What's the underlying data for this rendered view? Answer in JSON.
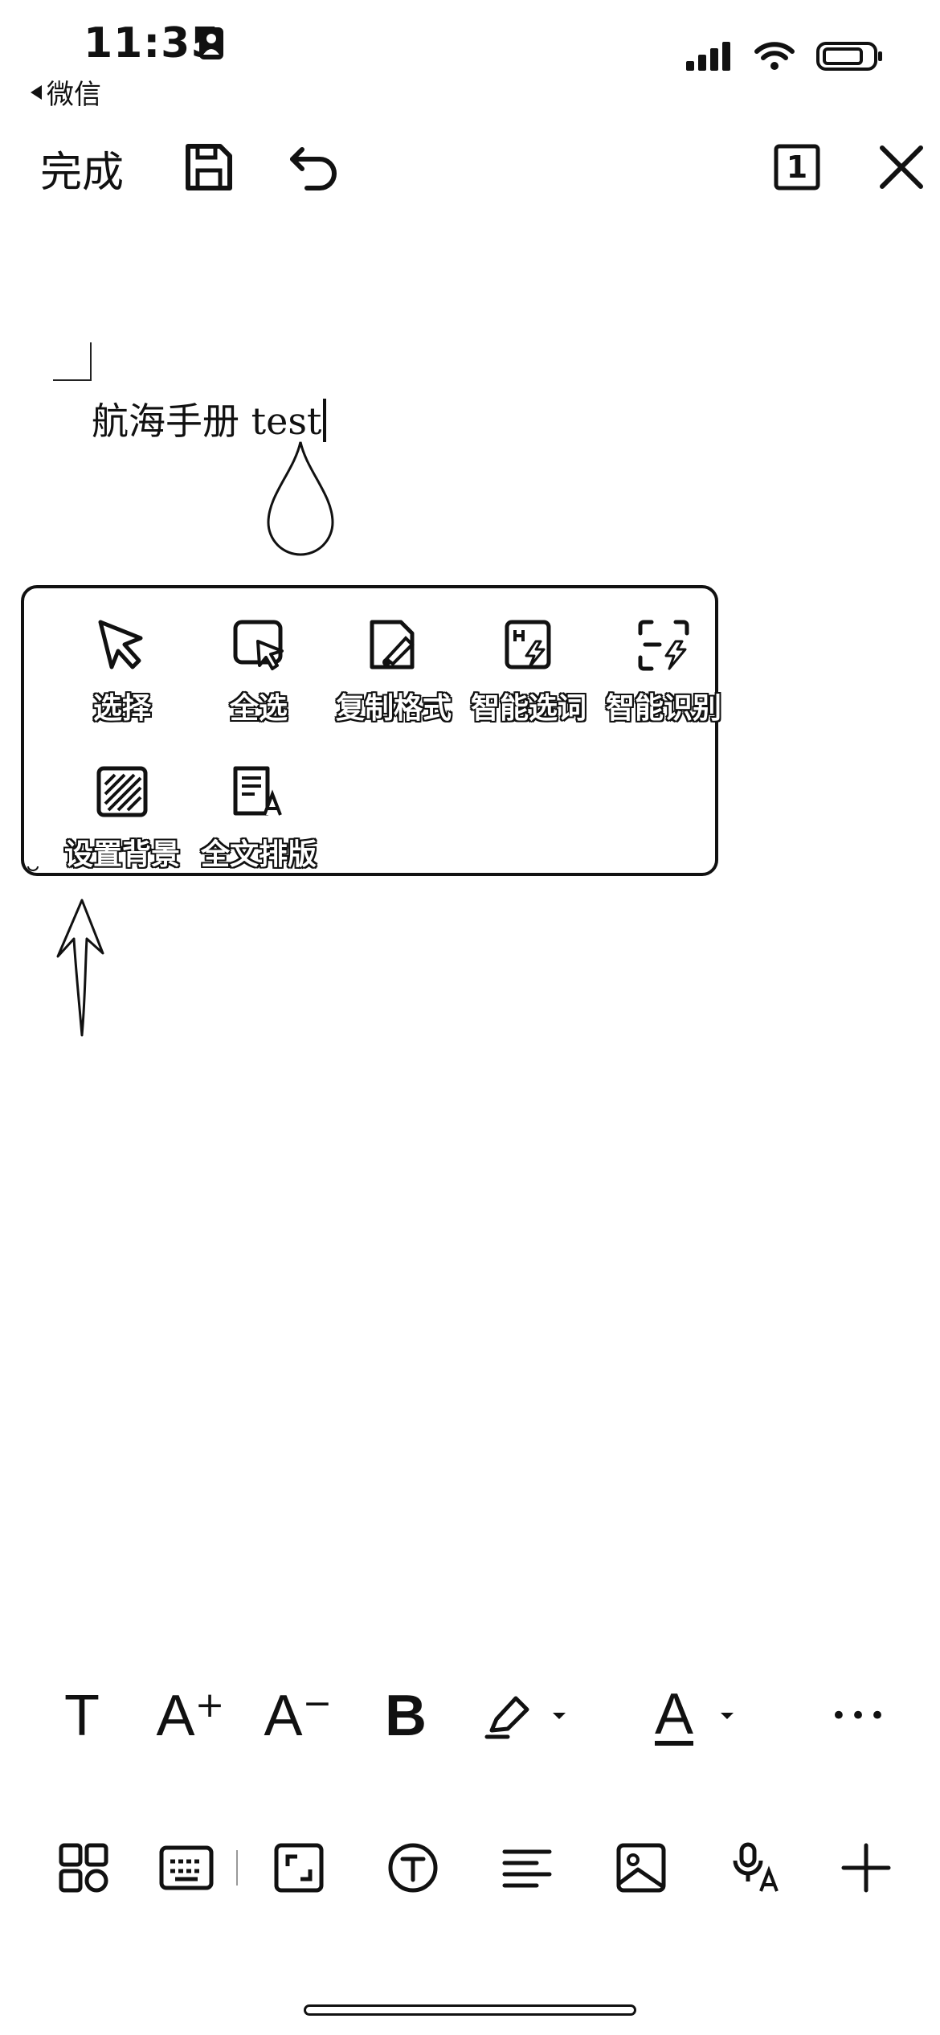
{
  "status_bar": {
    "time": "11:35",
    "back_app": "微信"
  },
  "toolbar": {
    "done_label": "完成",
    "page_count": "1"
  },
  "document": {
    "text": "航海手册 test"
  },
  "context_menu": {
    "items": [
      {
        "label": "选择",
        "icon": "cursor-icon"
      },
      {
        "label": "全选",
        "icon": "select-all-icon"
      },
      {
        "label": "复制格式",
        "icon": "format-painter-icon"
      },
      {
        "label": "智能选词",
        "icon": "smart-word-select-icon"
      },
      {
        "label": "智能识别",
        "icon": "smart-recognize-icon"
      },
      {
        "label": "设置背景",
        "icon": "background-pattern-icon"
      },
      {
        "label": "全文排版",
        "icon": "document-layout-icon"
      }
    ]
  },
  "format_bar": {
    "text_label": "T",
    "increase_font_label": "A",
    "increase_font_sign": "+",
    "decrease_font_label": "A",
    "decrease_font_sign": "−",
    "bold_label": "B",
    "font_color_label": "A",
    "more_label": "•••"
  },
  "colors": {
    "foreground": "#111111",
    "background": "#ffffff"
  }
}
